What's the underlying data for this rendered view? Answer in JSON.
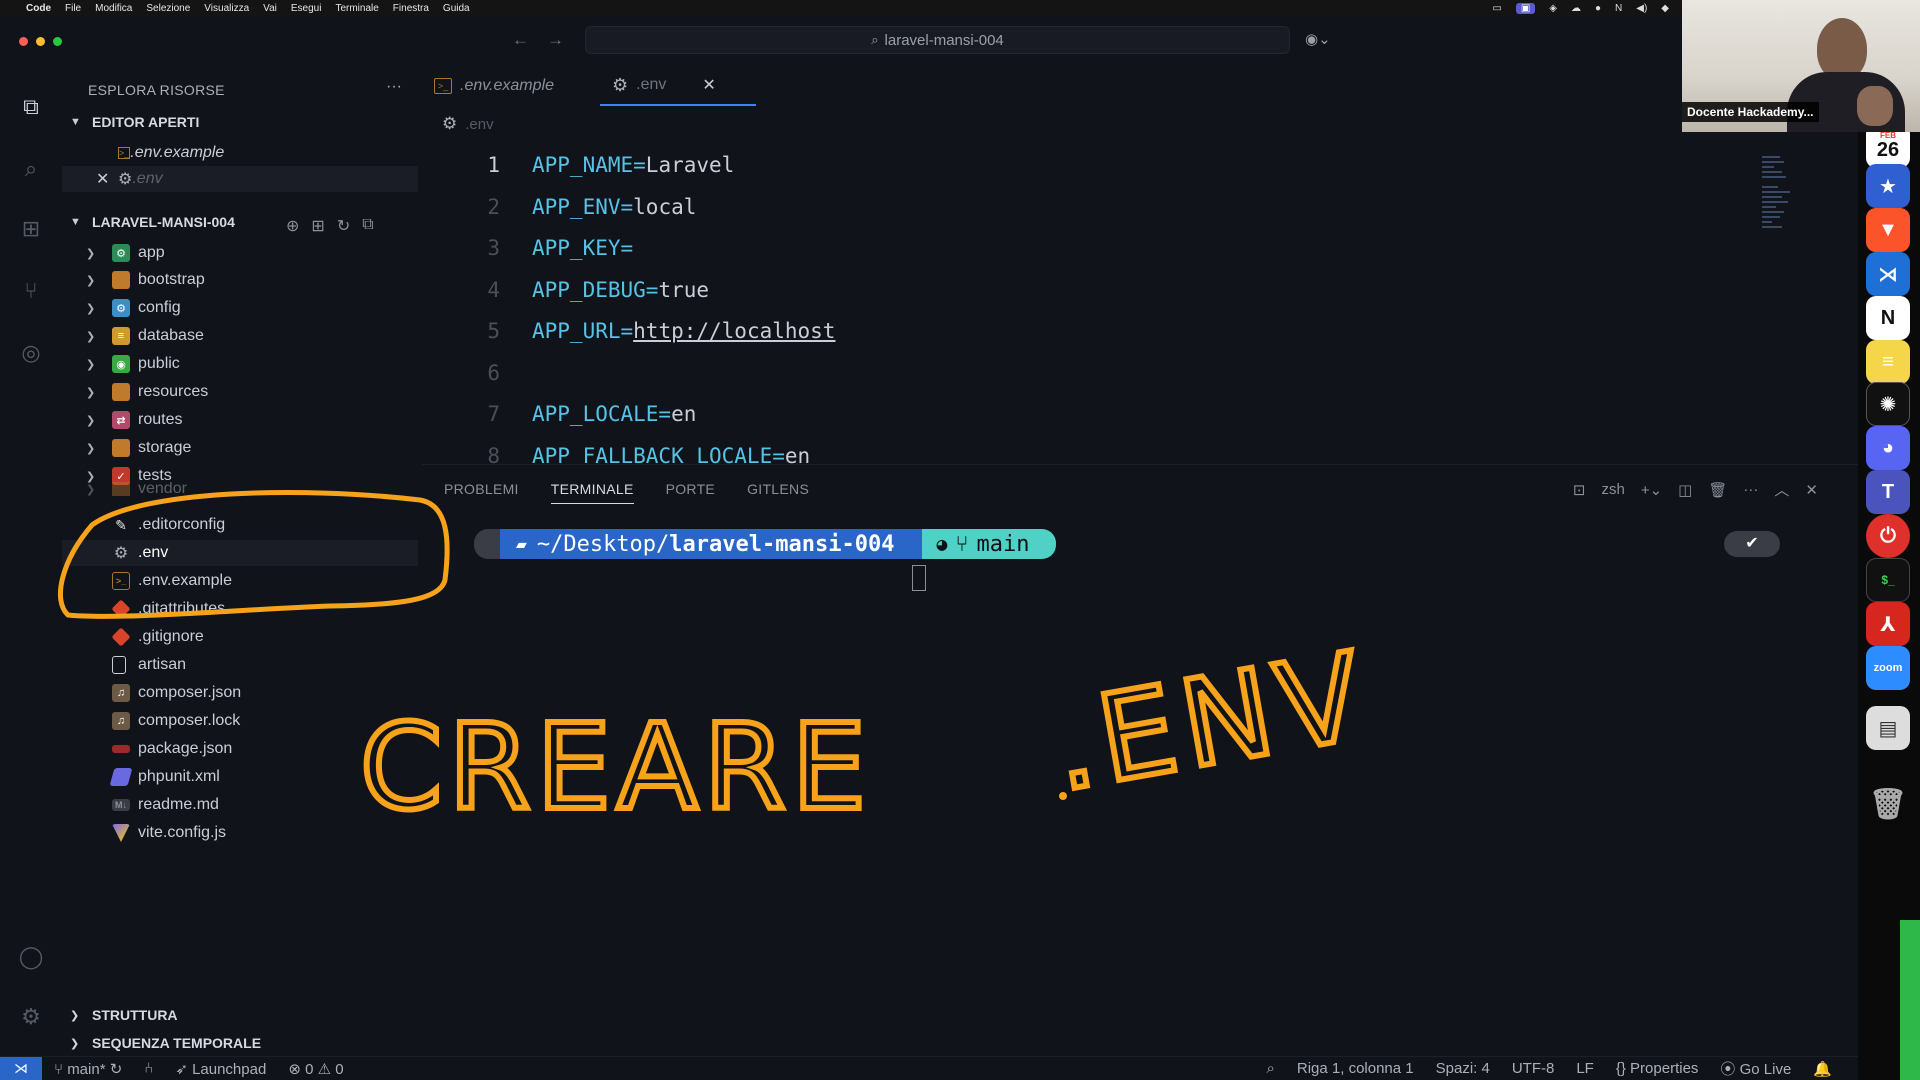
{
  "menubar": {
    "app": "Code",
    "items": [
      "File",
      "Modifica",
      "Selezione",
      "Visualizza",
      "Vai",
      "Esegui",
      "Terminale",
      "Finestra",
      "Guida"
    ]
  },
  "titlebar": {
    "search": "laravel-mansi-004"
  },
  "sidebar": {
    "header": "ESPLORA RISORSE",
    "open_editors_title": "EDITOR APERTI",
    "open_editors": [
      ".env.example",
      ".env"
    ],
    "project_title": "LARAVEL-MANSI-004",
    "folders": [
      "app",
      "bootstrap",
      "config",
      "database",
      "public",
      "resources",
      "routes",
      "storage",
      "tests",
      "vendor"
    ],
    "files": [
      ".editorconfig",
      ".env",
      ".env.example",
      ".gitattributes",
      ".gitignore",
      "artisan",
      "composer.json",
      "composer.lock",
      "package.json",
      "phpunit.xml",
      "readme.md",
      "vite.config.js"
    ],
    "bottom": [
      "STRUTTURA",
      "SEQUENZA TEMPORALE"
    ]
  },
  "editor": {
    "tabs": [
      ".env.example",
      ".env"
    ],
    "breadcrumb": ".env",
    "lines": [
      {
        "n": "1",
        "key": "APP_NAME=",
        "val": "Laravel",
        "link": false
      },
      {
        "n": "2",
        "key": "APP_ENV=",
        "val": "local",
        "link": false
      },
      {
        "n": "3",
        "key": "APP_KEY=",
        "val": "",
        "link": false
      },
      {
        "n": "4",
        "key": "APP_DEBUG=",
        "val": "true",
        "link": false
      },
      {
        "n": "5",
        "key": "APP_URL=",
        "val": "http://localhost",
        "link": true
      },
      {
        "n": "6",
        "key": "",
        "val": "",
        "link": false
      },
      {
        "n": "7",
        "key": "APP_LOCALE=",
        "val": "en",
        "link": false
      },
      {
        "n": "8",
        "key": "APP_FALLBACK_LOCALE=",
        "val": "en",
        "link": false
      }
    ]
  },
  "panel": {
    "tabs": [
      "PROBLEMI",
      "TERMINALE",
      "PORTE",
      "GITLENS"
    ],
    "shell": "zsh",
    "prompt_path_prefix": "~/Desktop/",
    "prompt_path_dir": "laravel-mansi-004",
    "prompt_branch": "main",
    "check": "✔"
  },
  "statusbar": {
    "branch": "main*",
    "launchpad": "Launchpad",
    "errors": "0",
    "warnings": "0",
    "position": "Riga 1, colonna 1",
    "spaces": "Spazi: 4",
    "encoding": "UTF-8",
    "eol": "LF",
    "language": "Properties",
    "golive": "Go Live"
  },
  "dock": {
    "calendar_month": "FEB",
    "calendar_day": "26",
    "zoom_label": "zoom"
  },
  "webcam": {
    "label": "Docente Hackademy..."
  },
  "annotation": {
    "word1": "CREARE",
    "word2": ".ENV",
    "color": "#f7a21b"
  }
}
